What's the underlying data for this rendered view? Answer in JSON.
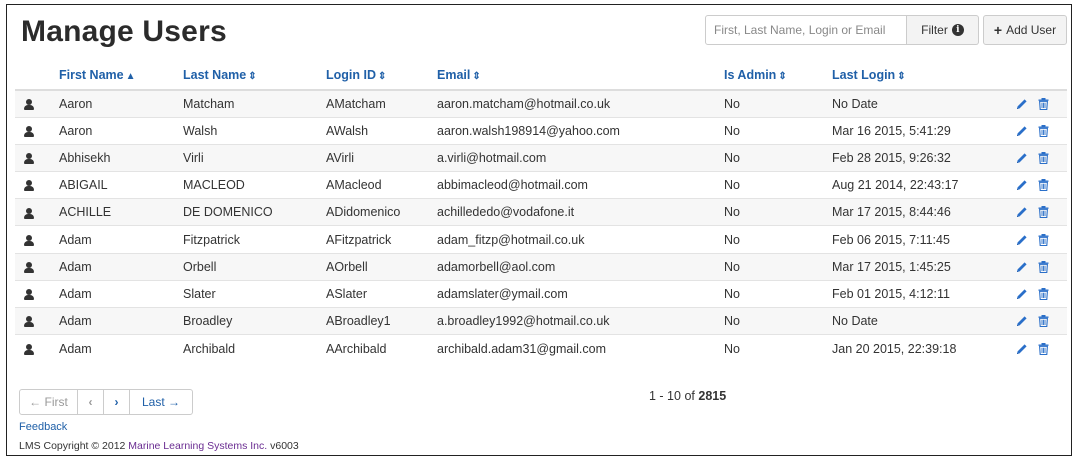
{
  "page": {
    "title": "Manage Users"
  },
  "search": {
    "placeholder": "First, Last Name, Login or Email",
    "value": ""
  },
  "toolbar": {
    "filter_label": "Filter",
    "filter_icon": "info-icon",
    "add_user_label": "Add User",
    "add_user_icon": "plus-icon"
  },
  "table": {
    "headers": {
      "first_name": "First Name",
      "last_name": "Last Name",
      "login_id": "Login ID",
      "email": "Email",
      "is_admin": "Is Admin",
      "last_login": "Last Login"
    },
    "sort_arrows": {
      "first_name": "▲",
      "last_name": "⇕",
      "login_id": "⇕",
      "email": "⇕",
      "is_admin": "⇕",
      "last_login": "⇕"
    },
    "rows": [
      {
        "first": "Aaron",
        "last": "Matcham",
        "login": "AMatcham",
        "email": "aaron.matcham@hotmail.co.uk",
        "admin": "No",
        "last_login": "No Date"
      },
      {
        "first": "Aaron",
        "last": "Walsh",
        "login": "AWalsh",
        "email": "aaron.walsh198914@yahoo.com",
        "admin": "No",
        "last_login": "Mar 16 2015, 5:41:29"
      },
      {
        "first": "Abhisekh",
        "last": "Virli",
        "login": "AVirli",
        "email": "a.virli@hotmail.com",
        "admin": "No",
        "last_login": "Feb 28 2015, 9:26:32"
      },
      {
        "first": "ABIGAIL",
        "last": "MACLEOD",
        "login": "AMacleod",
        "email": "abbimacleod@hotmail.com",
        "admin": "No",
        "last_login": "Aug 21 2014, 22:43:17"
      },
      {
        "first": "ACHILLE",
        "last": "DE DOMENICO",
        "login": "ADidomenico",
        "email": "achillededo@vodafone.it",
        "admin": "No",
        "last_login": "Mar 17 2015, 8:44:46"
      },
      {
        "first": "Adam",
        "last": "Fitzpatrick",
        "login": "AFitzpatrick",
        "email": "adam_fitzp@hotmail.co.uk",
        "admin": "No",
        "last_login": "Feb 06 2015, 7:11:45"
      },
      {
        "first": "Adam",
        "last": "Orbell",
        "login": "AOrbell",
        "email": "adamorbell@aol.com",
        "admin": "No",
        "last_login": "Mar 17 2015, 1:45:25"
      },
      {
        "first": "Adam",
        "last": "Slater",
        "login": "ASlater",
        "email": "adamslater@ymail.com",
        "admin": "No",
        "last_login": "Feb 01 2015, 4:12:11"
      },
      {
        "first": "Adam",
        "last": "Broadley",
        "login": "ABroadley1",
        "email": "a.broadley1992@hotmail.co.uk",
        "admin": "No",
        "last_login": "No Date"
      },
      {
        "first": "Adam",
        "last": "Archibald",
        "login": "AArchibald",
        "email": "archibald.adam31@gmail.com",
        "admin": "No",
        "last_login": "Jan 20 2015, 22:39:18"
      }
    ]
  },
  "pagination": {
    "first_label": "← First",
    "prev_label": "‹",
    "next_label": "›",
    "last_label": "Last →",
    "range": "1 - 10",
    "of_label": "of",
    "total": "2815"
  },
  "footer": {
    "feedback_label": "Feedback",
    "copyright_prefix": "LMS Copyright © 2012",
    "company": "Marine Learning Systems Inc.",
    "version": "v6003"
  },
  "colors": {
    "link": "#2060a8",
    "company": "#6a2c91",
    "row_stripe": "#f7f7f7"
  }
}
